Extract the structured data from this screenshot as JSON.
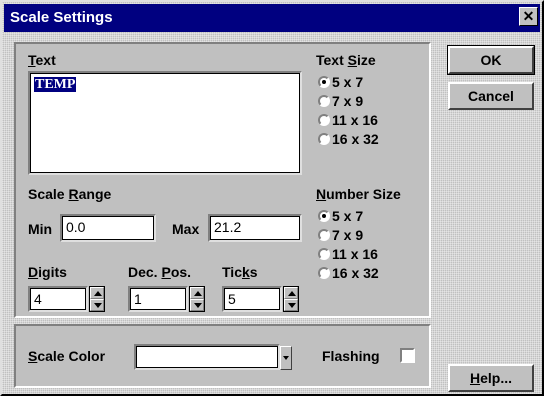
{
  "window": {
    "title": "Scale Settings",
    "close_glyph": "✕"
  },
  "text_section": {
    "label_pre": "",
    "label_key": "T",
    "label_post": "ext",
    "value": "TEMP"
  },
  "text_size": {
    "label_pre": "Text ",
    "label_key": "S",
    "label_post": "ize",
    "options": [
      "5 x 7",
      "7 x 9",
      "11 x 16",
      "16 x 32"
    ],
    "selected": "5 x 7"
  },
  "scale_range": {
    "label_pre": "Scale ",
    "label_key": "R",
    "label_post": "ange",
    "min_label": "Min",
    "min_value": "0.0",
    "max_label": "Max",
    "max_value": "21.2"
  },
  "number_size": {
    "label_pre": "",
    "label_key": "N",
    "label_post": "umber Size",
    "options": [
      "5 x 7",
      "7 x 9",
      "11 x 16",
      "16 x 32"
    ],
    "selected": "5 x 7"
  },
  "digits": {
    "label_pre": "",
    "label_key": "D",
    "label_post": "igits",
    "value": "4"
  },
  "dec_pos": {
    "label_pre": "Dec. ",
    "label_key": "P",
    "label_post": "os.",
    "value": "1"
  },
  "ticks": {
    "label_pre": "Tic",
    "label_key": "k",
    "label_post": "s",
    "value": "5"
  },
  "scale_color": {
    "label_pre": "",
    "label_key": "S",
    "label_post": "cale Color",
    "value": ""
  },
  "flashing": {
    "label": "Flashing",
    "checked": false
  },
  "buttons": {
    "ok": "OK",
    "cancel": "Cancel",
    "help_pre": "",
    "help_key": "H",
    "help_post": "elp..."
  }
}
